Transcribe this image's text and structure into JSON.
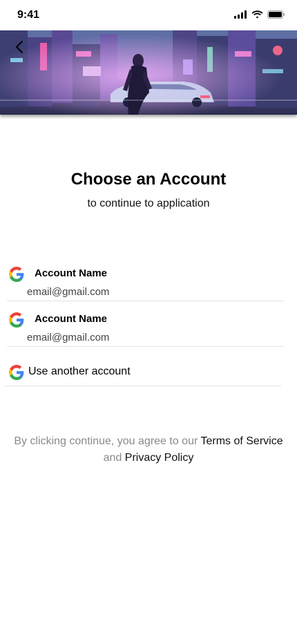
{
  "status_bar": {
    "time": "9:41"
  },
  "banner": {
    "back_icon": "chevron-left-icon"
  },
  "heading": {
    "title": "Choose an Account",
    "subtitle": "to continue to application"
  },
  "accounts": [
    {
      "name": "Account Name",
      "email": "email@gmail.com",
      "icon": "google-icon"
    },
    {
      "name": "Account Name",
      "email": "email@gmail.com",
      "icon": "google-icon"
    }
  ],
  "another_account": {
    "label": "Use another account",
    "icon": "google-icon"
  },
  "terms": {
    "prefix": "By clicking continue, you agree to our ",
    "terms_link": "Terms of Service",
    "conjunction": " and ",
    "privacy_link": "Privacy Policy"
  },
  "colors": {
    "google_blue": "#4285F4",
    "google_red": "#EA4335",
    "google_yellow": "#FBBC05",
    "google_green": "#34A853",
    "muted_text": "#8a8a8a",
    "divider": "#e3e3e3"
  }
}
